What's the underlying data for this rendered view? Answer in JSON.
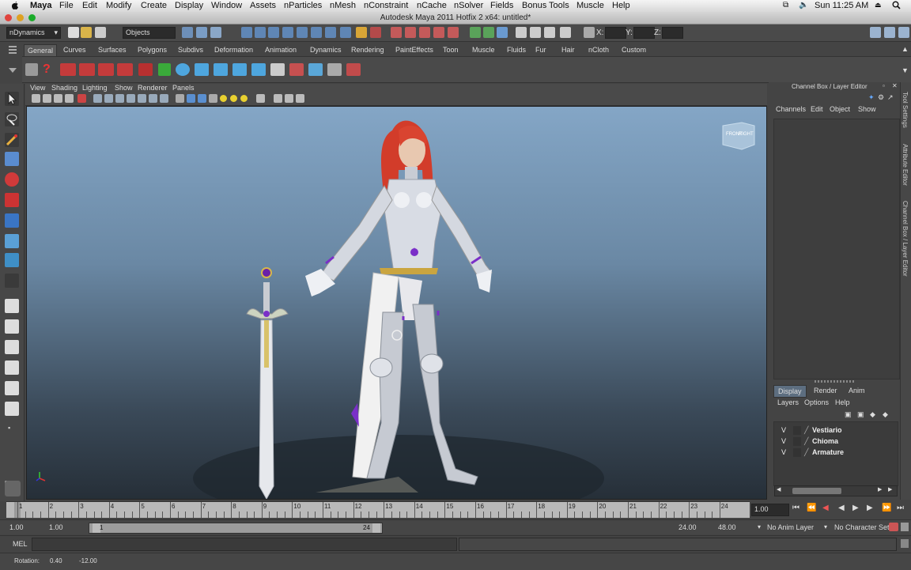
{
  "menubar": {
    "app": "Maya",
    "items": [
      "File",
      "Edit",
      "Modify",
      "Create",
      "Display",
      "Window",
      "Assets",
      "nParticles",
      "nMesh",
      "nConstraint",
      "nCache",
      "nSolver",
      "Fields",
      "Bonus Tools",
      "Muscle",
      "Help"
    ],
    "clock": "Sun 11:25 AM"
  },
  "window": {
    "title": "Autodesk Maya 2011 Hotfix 2 x64: untitled*"
  },
  "statusline": {
    "menuset": "nDynamics",
    "selection_field": "Objects",
    "x_label": "X:",
    "y_label": "Y:",
    "z_label": "Z:"
  },
  "shelf": {
    "tabs": [
      "General",
      "Curves",
      "Surfaces",
      "Polygons",
      "Subdivs",
      "Deformation",
      "Animation",
      "Dynamics",
      "Rendering",
      "PaintEffects",
      "Toon",
      "Muscle",
      "Fluids",
      "Fur",
      "Hair",
      "nCloth",
      "Custom"
    ],
    "active_tab": "General"
  },
  "viewport": {
    "menu": [
      "View",
      "Shading",
      "Lighting",
      "Show",
      "Renderer",
      "Panels"
    ],
    "viewcube": {
      "front": "FRONT",
      "right": "RIGHT"
    }
  },
  "channelbox": {
    "header": "Channel Box / Layer Editor",
    "menu": [
      "Channels",
      "Edit",
      "Object",
      "Show"
    ]
  },
  "sidetabs": [
    "Tool Settings",
    "Attribute Editor",
    "Channel Box / Layer Editor"
  ],
  "layers": {
    "tabs": [
      "Display",
      "Render",
      "Anim"
    ],
    "active_tab": "Display",
    "menu": [
      "Layers",
      "Options",
      "Help"
    ],
    "items": [
      {
        "visible": "V",
        "name": "Vestiario"
      },
      {
        "visible": "V",
        "name": "Chioma"
      },
      {
        "visible": "V",
        "name": "Armature"
      }
    ]
  },
  "timeslider": {
    "ticks": [
      "1",
      "2",
      "3",
      "4",
      "5",
      "6",
      "7",
      "8",
      "9",
      "10",
      "11",
      "12",
      "13",
      "14",
      "15",
      "16",
      "17",
      "18",
      "19",
      "20",
      "21",
      "22",
      "23",
      "24"
    ],
    "current_frame": "1.00"
  },
  "range": {
    "start": "1.00",
    "playback_start": "1.00",
    "slider_start": "1",
    "slider_end": "24",
    "playback_end": "24.00",
    "end": "48.00",
    "anim_layer": "No Anim Layer",
    "character_set": "No Character Set"
  },
  "commandline": {
    "label": "MEL"
  },
  "helpline": {
    "label": "Rotation:",
    "value1": "0.40",
    "value2": "-12.00"
  },
  "colors": {
    "accent": "#5d6e80",
    "viewport_top": "#84a6c6",
    "viewport_bottom": "#262f38",
    "purple_trim": "#7a2fc8"
  }
}
